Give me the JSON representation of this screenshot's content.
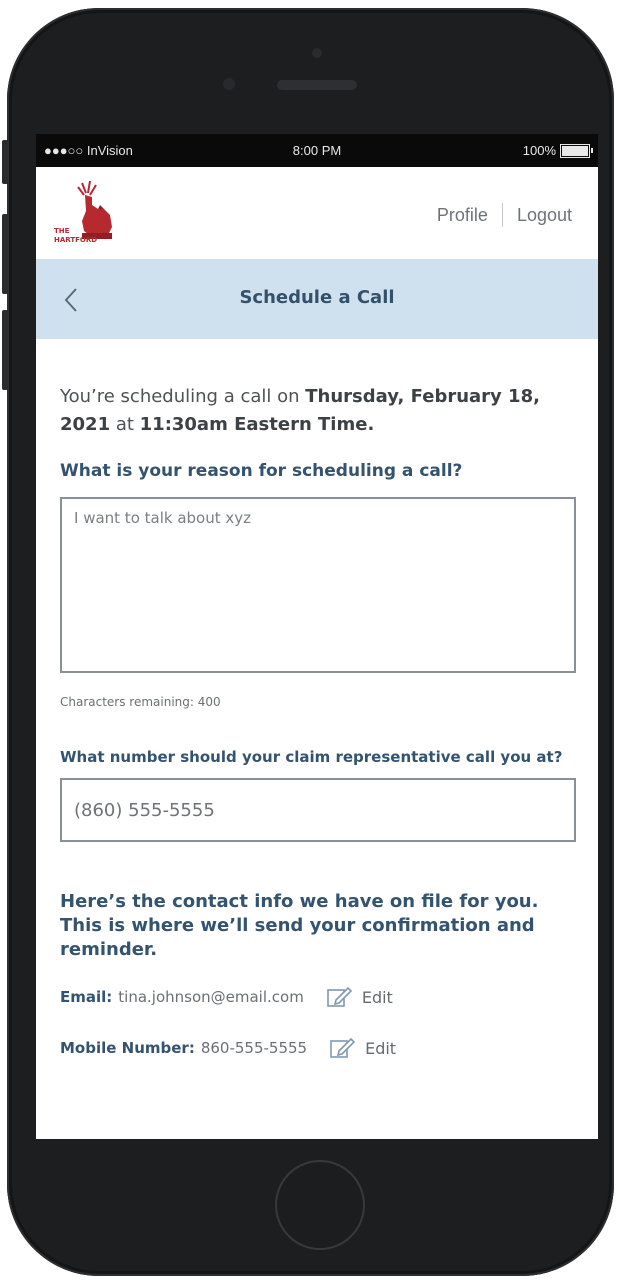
{
  "status_bar": {
    "carrier": "●●●○○ InVision",
    "time": "8:00 PM",
    "battery": "100%"
  },
  "header": {
    "logo_text_line1": "THE",
    "logo_text_line2": "HARTFORD",
    "profile_label": "Profile",
    "logout_label": "Logout"
  },
  "title_bar": {
    "title": "Schedule a Call"
  },
  "intro": {
    "prefix": "You’re scheduling a call on ",
    "date": "Thursday, February 18, 2021",
    "mid": " at ",
    "time": "11:30am Eastern Time."
  },
  "reason": {
    "question": "What is your reason for scheduling a call?",
    "value": "I want to talk about xyz",
    "char_remaining": "Characters remaining: 400"
  },
  "callback": {
    "question": "What number should your claim representative call you at?",
    "value": "(860) 555-5555"
  },
  "contact": {
    "heading": "Here’s the contact info we have on file for you. This is where we’ll send your confirmation and reminder.",
    "email_label": "Email:",
    "email_value": "tina.johnson@email.com",
    "mobile_label": "Mobile Number:",
    "mobile_value": "860-555-5555",
    "edit_label": "Edit"
  },
  "colors": {
    "title_bar_bg": "#cfe1ef",
    "accent_text": "#33536f",
    "logo_red": "#b5292f"
  }
}
